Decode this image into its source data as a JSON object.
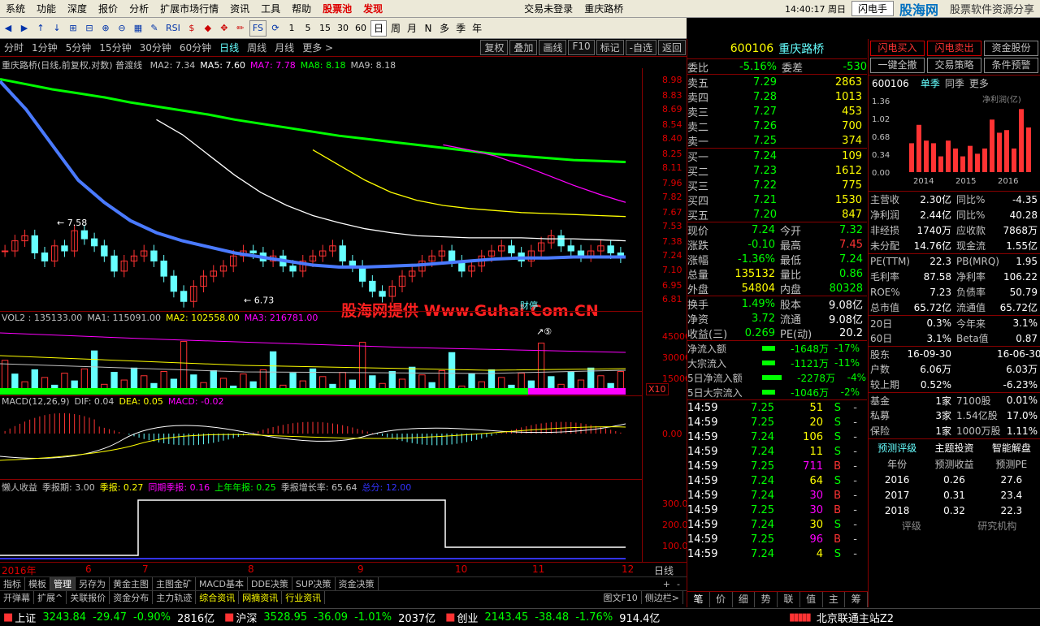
{
  "menu": [
    "系统",
    "功能",
    "深度",
    "报价",
    "分析",
    "扩展市场行情",
    "资讯",
    "工具",
    "帮助",
    "股票池",
    "发现"
  ],
  "menu_center": "交易未登录",
  "menu_stock": "重庆路桥",
  "clock": "14:40:17 周日",
  "flash_label": "闪电手",
  "watermark_logo": "股海网",
  "watermark_slogan": "股票软件资源分享",
  "watermark_url": "www.Guhai.com.cn",
  "toolbar_numbers": [
    "1",
    "5",
    "15",
    "30",
    "60"
  ],
  "toolbar_periods": [
    "日",
    "周",
    "月",
    "N",
    "多",
    "季",
    "年"
  ],
  "toolbar_rsi": "RSI",
  "toolbar_fs": "FS",
  "periods": [
    "分时",
    "1分钟",
    "5分钟",
    "15分钟",
    "30分钟",
    "60分钟",
    "日线",
    "周线",
    "月线",
    "更多 >"
  ],
  "period_buttons": [
    "复权",
    "叠加",
    "画线",
    "F10",
    "标记",
    "-自选",
    "返回"
  ],
  "main_title": "重庆路桥(日线,前复权,对数) 普渡线",
  "ma": [
    {
      "label": "MA2: 7.34",
      "color": "#c0c0c0"
    },
    {
      "label": "MA5: 7.60",
      "color": "#fff"
    },
    {
      "label": "MA7: 7.78",
      "color": "#f0f"
    },
    {
      "label": "MA8: 8.18",
      "color": "#0f0"
    },
    {
      "label": "MA9: 8.18",
      "color": "#c0c0c0"
    }
  ],
  "price_axis": [
    "8.98",
    "8.83",
    "8.69",
    "8.54",
    "8.40",
    "8.25",
    "8.11",
    "7.96",
    "7.82",
    "7.67",
    "7.53",
    "7.38",
    "7.24",
    "7.10",
    "6.95",
    "6.81"
  ],
  "high_label": "7.58",
  "low_label": "6.73",
  "event_label": "财停",
  "watermark_text": "股海网提供 Www.Guhai.Com.CN",
  "vol_title": [
    {
      "t": "VOL2 : 135133.00",
      "c": "#c0c0c0"
    },
    {
      "t": "MA1: 115091.00",
      "c": "#c0c0c0"
    },
    {
      "t": "MA2: 102558.00",
      "c": "#ff0"
    },
    {
      "t": "MA3: 216781.00",
      "c": "#f0f"
    }
  ],
  "vol_axis": [
    "45000",
    "30000",
    "15000"
  ],
  "vol_unit": "X10",
  "vol_marker": "⑤",
  "macd_title": [
    {
      "t": "MACD(12,26,9)",
      "c": "#c0c0c0"
    },
    {
      "t": "DIF: 0.04",
      "c": "#c0c0c0"
    },
    {
      "t": "DEA: 0.05",
      "c": "#ff0"
    },
    {
      "t": "MACD: -0.02",
      "c": "#f0f"
    }
  ],
  "macd_axis": [
    "0.00"
  ],
  "lazy_title": [
    {
      "t": "懒人收益",
      "c": "#c0c0c0"
    },
    {
      "t": "季报期: 3.00",
      "c": "#c0c0c0"
    },
    {
      "t": "季报: 0.27",
      "c": "#ff0"
    },
    {
      "t": "同期季报: 0.16",
      "c": "#f0f"
    },
    {
      "t": "上年年报: 0.25",
      "c": "#0f0"
    },
    {
      "t": "季报增长率: 65.64",
      "c": "#c0c0c0"
    },
    {
      "t": "总分: 12.00",
      "c": "#33f"
    }
  ],
  "lazy_axis": [
    "300.0",
    "200.0",
    "100.0"
  ],
  "date_axis": [
    "2016年",
    "6",
    "7",
    "8",
    "9",
    "10",
    "11",
    "12"
  ],
  "date_unit": "日线",
  "bottom_tabs1": [
    "指标",
    "模板",
    "管理",
    "另存为",
    "黄金主图",
    "主图金矿",
    "MACD基本",
    "DDE决策",
    "SUP决策",
    "资金决策"
  ],
  "bottom_tabs2": [
    "开弹幕",
    "扩展^",
    "关联报价",
    "资金分布",
    "主力轨迹",
    "综合资讯",
    "网摘资讯",
    "行业资讯"
  ],
  "bottom_right": [
    "图文F10",
    "侧边栏>"
  ],
  "bottom_nav": [
    "+",
    "-"
  ],
  "quote": {
    "code": "600106",
    "name": "重庆路桥",
    "wb": [
      "委比",
      "-5.16%",
      "委差",
      "-530"
    ],
    "sell": [
      [
        "卖五",
        "7.29",
        "2863"
      ],
      [
        "卖四",
        "7.28",
        "1013"
      ],
      [
        "卖三",
        "7.27",
        "453"
      ],
      [
        "卖二",
        "7.26",
        "700"
      ],
      [
        "卖一",
        "7.25",
        "374"
      ]
    ],
    "buy": [
      [
        "买一",
        "7.24",
        "109"
      ],
      [
        "买二",
        "7.23",
        "1612"
      ],
      [
        "买三",
        "7.22",
        "775"
      ],
      [
        "买四",
        "7.21",
        "1530"
      ],
      [
        "买五",
        "7.20",
        "847"
      ]
    ],
    "stats": [
      [
        "现价",
        "7.24",
        "今开",
        "7.32"
      ],
      [
        "涨跌",
        "-0.10",
        "最高",
        "7.45"
      ],
      [
        "涨幅",
        "-1.36%",
        "最低",
        "7.24"
      ],
      [
        "总量",
        "135132",
        "量比",
        "0.86"
      ],
      [
        "外盘",
        "54804",
        "内盘",
        "80328"
      ]
    ],
    "stats2": [
      [
        "换手",
        "1.49%",
        "股本",
        "9.08亿"
      ],
      [
        "净资",
        "3.72",
        "流通",
        "9.08亿"
      ],
      [
        "收益(三)",
        "0.269",
        "PE(动)",
        "20.2"
      ]
    ],
    "flows": [
      [
        "净流入额",
        "-1648万",
        "-17%"
      ],
      [
        "大宗流入",
        "-1121万",
        "-11%"
      ],
      [
        "5日净流入额",
        "-2278万",
        "-4%"
      ],
      [
        "5日大宗流入",
        "-1046万",
        "-2%"
      ]
    ],
    "ticks": [
      [
        "14:59",
        "7.25",
        "51",
        "S"
      ],
      [
        "14:59",
        "7.25",
        "20",
        "S"
      ],
      [
        "14:59",
        "7.24",
        "106",
        "S"
      ],
      [
        "14:59",
        "7.24",
        "11",
        "S"
      ],
      [
        "14:59",
        "7.25",
        "711",
        "B"
      ],
      [
        "14:59",
        "7.24",
        "64",
        "S"
      ],
      [
        "14:59",
        "7.24",
        "30",
        "B"
      ],
      [
        "14:59",
        "7.25",
        "30",
        "B"
      ],
      [
        "14:59",
        "7.24",
        "30",
        "S"
      ],
      [
        "14:59",
        "7.25",
        "96",
        "B"
      ],
      [
        "14:59",
        "7.24",
        "4",
        "S"
      ]
    ],
    "tabs": [
      "笔",
      "价",
      "细",
      "势",
      "联",
      "值",
      "主",
      "筹"
    ]
  },
  "right": {
    "buttons": [
      [
        "闪电买入",
        "闪电卖出",
        "资金股份"
      ],
      [
        "一键全撤",
        "交易策略",
        "条件预警"
      ]
    ],
    "code": "600106",
    "tabs": [
      "单季",
      "同季",
      "更多"
    ],
    "chart_label": "净利润(亿)",
    "bar_axis": [
      "1.36",
      "1.02",
      "0.68",
      "0.34",
      "0.00"
    ],
    "years": [
      "2014",
      "2015",
      "2016"
    ],
    "bars": [
      0.55,
      0.9,
      0.6,
      0.55,
      0.3,
      0.6,
      0.45,
      0.3,
      0.5,
      0.35,
      0.45,
      1.0,
      0.75,
      0.8,
      0.45,
      1.2,
      0.85
    ],
    "fin": [
      [
        "主营收",
        "2.30亿",
        "同比%",
        "-4.35"
      ],
      [
        "净利润",
        "2.44亿",
        "同比%",
        "40.28"
      ],
      [
        "非经损",
        "1740万",
        "应收款",
        "7868万"
      ],
      [
        "未分配",
        "14.76亿",
        "现金流",
        "1.55亿"
      ],
      [
        "PE(TTM)",
        "22.3",
        "PB(MRQ)",
        "1.95"
      ],
      [
        "毛利率",
        "87.58",
        "净利率",
        "106.22"
      ],
      [
        "ROE%",
        "7.23",
        "负债率",
        "50.79"
      ],
      [
        "总市值",
        "65.72亿",
        "流通值",
        "65.72亿"
      ],
      [
        "20日",
        "0.3%",
        "今年来",
        "3.1%"
      ],
      [
        "60日",
        "3.1%",
        "Beta值",
        "0.87"
      ],
      [
        "股东",
        "16-09-30",
        "",
        "16-06-30"
      ],
      [
        "户数",
        "6.06万",
        "",
        "6.03万"
      ],
      [
        "较上期",
        "0.52%",
        "",
        "-6.23%"
      ],
      [
        "基金",
        "1家",
        "7100股",
        "0.01%"
      ],
      [
        "私募",
        "3家",
        "1.54亿股",
        "17.0%"
      ],
      [
        "保险",
        "1家",
        "1000万股",
        "1.11%"
      ]
    ],
    "fc_tabs": [
      "预测评级",
      "主题投资",
      "智能解盘"
    ],
    "fc_head": [
      "年份",
      "预测收益",
      "预测PE"
    ],
    "fc": [
      [
        "2016",
        "0.26",
        "27.6"
      ],
      [
        "2017",
        "0.31",
        "23.4"
      ],
      [
        "2018",
        "0.32",
        "22.3"
      ]
    ],
    "fc_bottom": [
      "评级",
      "研究机构"
    ]
  },
  "index": [
    {
      "name": "上证",
      "val": "3243.84",
      "chg": "-29.47",
      "pct": "-0.90%",
      "amt": "2816亿"
    },
    {
      "name": "沪深",
      "val": "3528.95",
      "chg": "-36.09",
      "pct": "-1.01%",
      "amt": "2037亿"
    },
    {
      "name": "创业",
      "val": "2143.45",
      "chg": "-38.48",
      "pct": "-1.76%",
      "amt": "914.4亿"
    }
  ],
  "server": "北京联通主站Z2",
  "colors": {
    "up": "#f33",
    "down": "#6ff",
    "ma5": "#fff",
    "ma7": "#f0f",
    "ma8": "#0f0",
    "ma_blue": "#4a7aff",
    "ma_yellow": "#ff0"
  },
  "chart_data": {
    "type": "candlestick",
    "series": [
      {
        "name": "MA8",
        "color": "#0f0",
        "values": [
          9.0,
          8.95,
          8.9,
          8.86,
          8.82,
          8.77,
          8.73,
          8.69,
          8.65,
          8.6,
          8.56,
          8.52,
          8.48,
          8.44,
          8.41,
          8.38,
          8.35,
          8.32,
          8.29,
          8.26,
          8.24,
          8.22,
          8.2,
          8.19,
          8.18
        ]
      },
      {
        "name": "MA7",
        "color": "#f0f",
        "values": [
          null,
          null,
          null,
          null,
          null,
          null,
          null,
          null,
          null,
          null,
          null,
          null,
          null,
          null,
          null,
          null,
          null,
          8.35,
          8.3,
          8.24,
          8.15,
          8.05,
          7.95,
          7.86,
          7.78
        ]
      },
      {
        "name": "MA5",
        "color": "#fff",
        "values": [
          null,
          null,
          null,
          null,
          null,
          null,
          8.6,
          8.45,
          8.25,
          8.05,
          7.88,
          7.75,
          7.65,
          7.58,
          7.52,
          7.48,
          7.45,
          7.44,
          7.43,
          7.43,
          7.43,
          7.42,
          7.42,
          7.41,
          7.4
        ]
      },
      {
        "name": "yellow",
        "color": "#ff0",
        "values": [
          null,
          null,
          null,
          null,
          null,
          null,
          null,
          null,
          null,
          null,
          null,
          null,
          8.3,
          8.15,
          8.0,
          7.88,
          7.8,
          7.75,
          7.72,
          7.7,
          7.68,
          7.67,
          7.66,
          7.65,
          7.64
        ]
      },
      {
        "name": "blue",
        "color": "#4a7aff",
        "values": [
          8.98,
          8.7,
          8.35,
          8.0,
          7.78,
          7.6,
          7.48,
          7.4,
          7.34,
          7.28,
          7.24,
          7.2,
          7.16,
          7.14,
          7.14,
          7.15,
          7.16,
          7.18,
          7.2,
          7.22,
          7.23,
          7.23,
          7.24,
          7.24,
          7.24
        ]
      }
    ],
    "closes": [
      7.3,
      7.4,
      7.45,
      7.28,
      7.2,
      7.35,
      7.3,
      7.5,
      7.42,
      7.35,
      7.25,
      7.1,
      7.2,
      7.25,
      7.3,
      7.2,
      7.05,
      6.9,
      6.8,
      6.95,
      7.05,
      7.1,
      7.15,
      7.25,
      7.3,
      7.28,
      7.2,
      7.25,
      7.15,
      7.1,
      7.2,
      7.25,
      7.3,
      7.35,
      7.2,
      7.15,
      7.0,
      6.9,
      6.85,
      6.95,
      7.05,
      7.1,
      7.2,
      7.25,
      7.3,
      7.2,
      7.1,
      7.15,
      7.25,
      7.3,
      7.35,
      7.28,
      7.2,
      7.3,
      7.38,
      7.45,
      7.35,
      7.3,
      7.25,
      7.3,
      7.35,
      7.28,
      7.24
    ],
    "ylim": [
      6.81,
      8.98
    ]
  }
}
